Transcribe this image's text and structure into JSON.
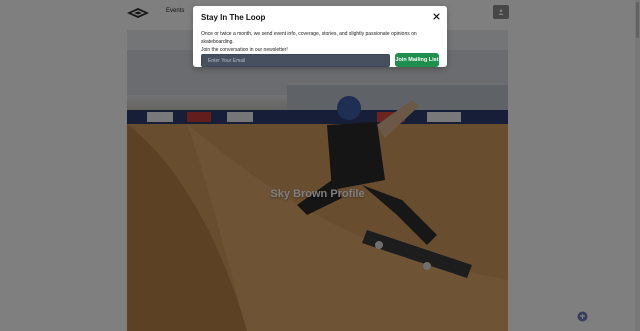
{
  "nav": {
    "links": [
      "Events",
      ""
    ],
    "user_icon": "user-icon",
    "logo_icon": "skateboard-logo-icon"
  },
  "hero": {
    "title": "Sky Brown Profile"
  },
  "modal": {
    "title": "Stay In The Loop",
    "close_icon": "close-icon",
    "body_line1": "Once or twice a month, we send event info, coverage, stories, and slightly passionate opinions on skateboarding.",
    "body_line2": "Join the conversation in our newsletter!",
    "email_placeholder": "Enter Your Email",
    "email_value": "",
    "submit_label": "Join Mailing List"
  },
  "colors": {
    "overlay": "#000000",
    "submit_button": "#1e8f4e",
    "email_field": "#46505f",
    "modal_bg": "#ffffff"
  }
}
